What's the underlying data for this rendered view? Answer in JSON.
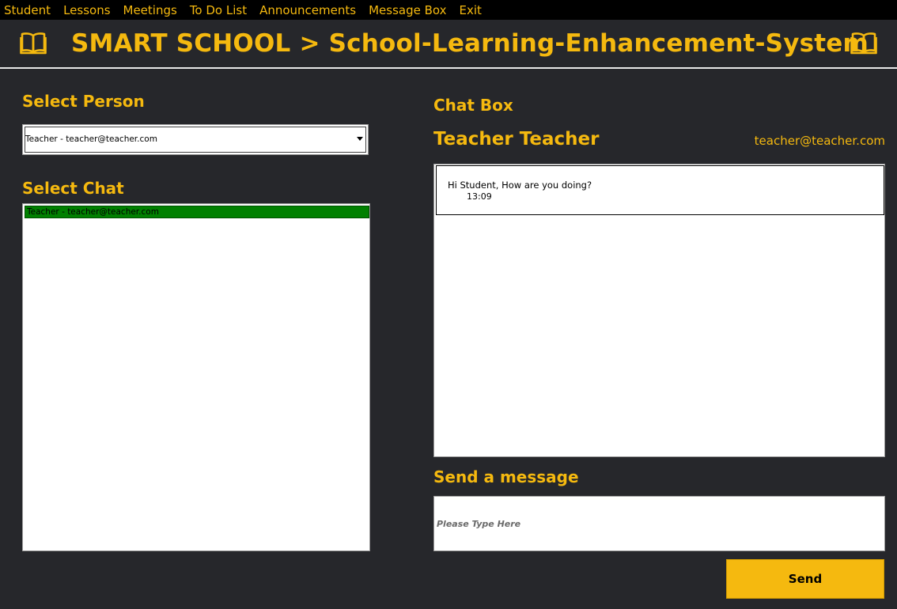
{
  "menu": {
    "items": [
      {
        "label": "Student"
      },
      {
        "label": "Lessons"
      },
      {
        "label": "Meetings"
      },
      {
        "label": "To Do List"
      },
      {
        "label": "Announcements"
      },
      {
        "label": "Message Box"
      },
      {
        "label": "Exit"
      }
    ]
  },
  "header": {
    "title": "SMART SCHOOL > School-Learning-Enhancement-System",
    "icon": "book-icon"
  },
  "left": {
    "select_person_label": "Select  Person",
    "person_select_value": "Teacher - teacher@teacher.com",
    "select_chat_label": "Select  Chat",
    "chat_items": [
      {
        "label": "Teacher - teacher@teacher.com",
        "selected": true
      }
    ]
  },
  "right": {
    "chat_box_label": "Chat Box",
    "contact_name": "Teacher Teacher",
    "contact_email": "teacher@teacher.com",
    "messages": [
      {
        "text": "Hi Student, How are you doing?",
        "time": "13:09"
      }
    ],
    "send_label": "Send a message",
    "input_placeholder": "Please Type Here",
    "send_button": "Send"
  },
  "colors": {
    "background": "#26272b",
    "menubar": "#000000",
    "accent": "#f5b90f",
    "selected_row": "#008000"
  }
}
